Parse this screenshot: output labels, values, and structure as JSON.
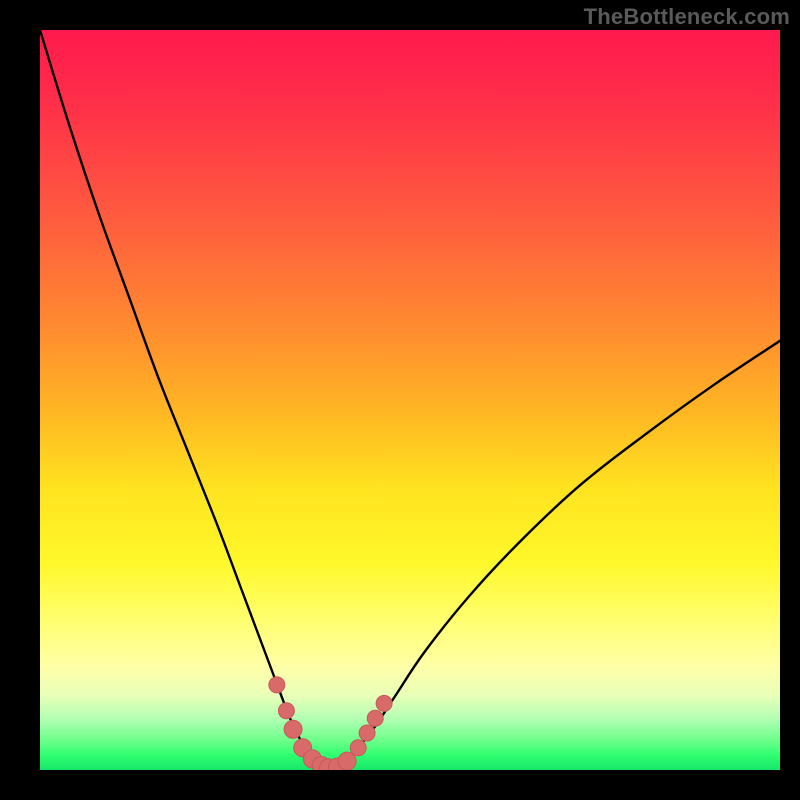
{
  "watermark": "TheBottleneck.com",
  "colors": {
    "background": "#000000",
    "curve": "#000000",
    "marker_fill": "#d86a6a",
    "marker_stroke": "#c85858"
  },
  "chart_data": {
    "type": "line",
    "title": "",
    "xlabel": "",
    "ylabel": "",
    "ylim": [
      0,
      100
    ],
    "xlim": [
      0,
      100
    ],
    "x": [
      0,
      4,
      8,
      12,
      16,
      20,
      24,
      27,
      30,
      33,
      34,
      35.5,
      37,
      38,
      39,
      40,
      41,
      42.5,
      45,
      48,
      52,
      58,
      65,
      73,
      82,
      91,
      100
    ],
    "values": [
      100,
      87,
      75,
      64,
      53,
      43,
      33,
      25,
      17,
      9,
      6.5,
      3.5,
      1.2,
      0.4,
      0,
      0.3,
      1.0,
      2.5,
      5.5,
      10,
      16,
      23.5,
      31,
      38.5,
      45.5,
      52,
      58
    ],
    "markers": {
      "x": [
        32.0,
        33.3,
        34.2,
        35.5,
        36.8,
        38.0,
        39.0,
        40.2,
        41.5,
        43.0,
        44.2,
        45.3,
        46.5
      ],
      "y": [
        11.5,
        8.0,
        5.5,
        3.0,
        1.5,
        0.6,
        0.3,
        0.4,
        1.2,
        3.0,
        5.0,
        7.0,
        9.0
      ],
      "radius": [
        8,
        8,
        9,
        9,
        9,
        9,
        9,
        9,
        9,
        8,
        8,
        8,
        8
      ]
    }
  }
}
